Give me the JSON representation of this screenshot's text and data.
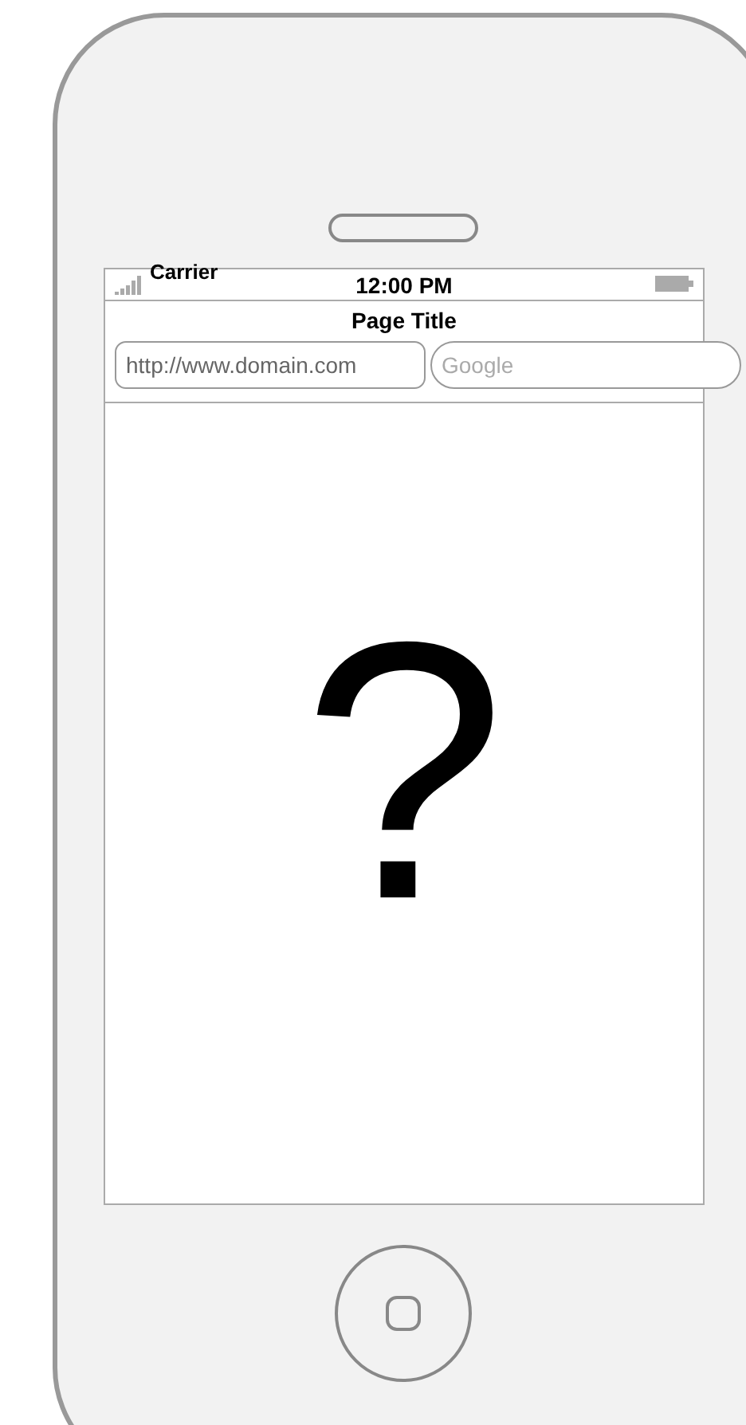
{
  "status_bar": {
    "carrier": "Carrier",
    "time": "12:00 PM"
  },
  "nav_bar": {
    "title": "Page Title"
  },
  "address_bar": {
    "url": "http://www.domain.com",
    "search_placeholder": "Google"
  },
  "content": {
    "symbol": "?"
  }
}
